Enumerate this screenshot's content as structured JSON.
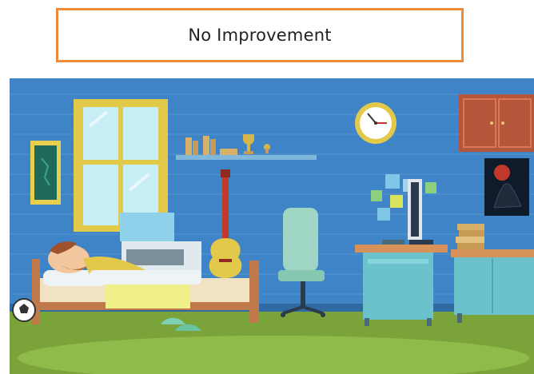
{
  "banner": {
    "label": "No Improvement",
    "border_color": "#ed8a3a"
  },
  "scene": {
    "icons": [
      "framed-picture-icon",
      "window-icon",
      "bookshelf-icon",
      "trophy-icon",
      "wall-clock-icon",
      "cabinet-icon",
      "poster-icon",
      "guitar-icon",
      "bed-icon",
      "sleeping-man-icon",
      "soccer-ball-icon",
      "sneakers-icon",
      "office-chair-icon",
      "desk-icon",
      "monitor-icon",
      "sticky-notes-icon",
      "book-stack-icon",
      "sideboard-icon"
    ],
    "colors": {
      "wall": "#3f84c6",
      "floor": "#7aa33a",
      "rug": "#8fbb4a"
    }
  }
}
